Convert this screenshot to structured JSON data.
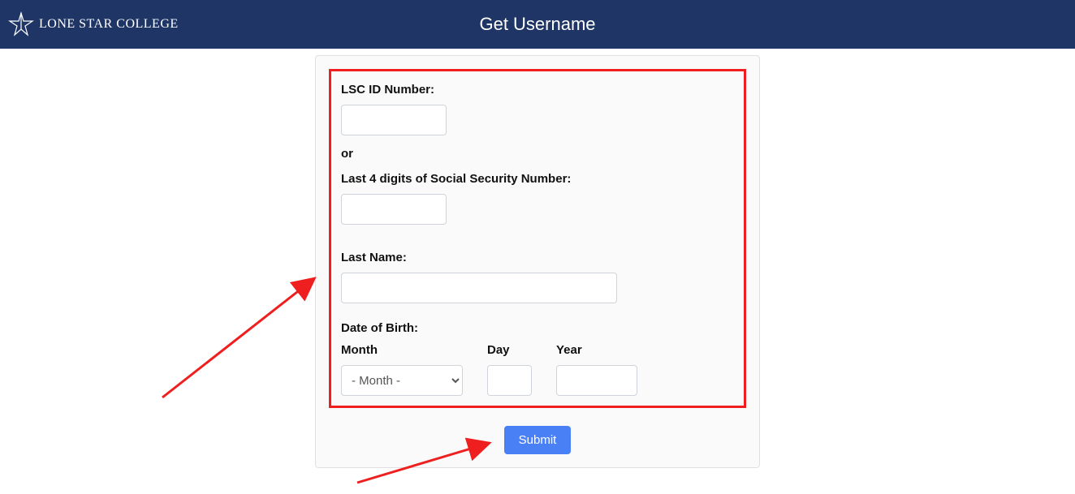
{
  "header": {
    "logo_text": "LONE STAR COLLEGE",
    "title": "Get Username"
  },
  "form": {
    "lsc_id_label": "LSC ID Number:",
    "lsc_id_value": "",
    "or_text": "or",
    "ssn_label": "Last 4 digits of Social Security Number:",
    "ssn_value": "",
    "last_name_label": "Last Name:",
    "last_name_value": "",
    "dob_label": "Date of Birth:",
    "month_label": "Month",
    "month_selected": "- Month -",
    "day_label": "Day",
    "day_value": "",
    "year_label": "Year",
    "year_value": "",
    "submit_label": "Submit"
  }
}
